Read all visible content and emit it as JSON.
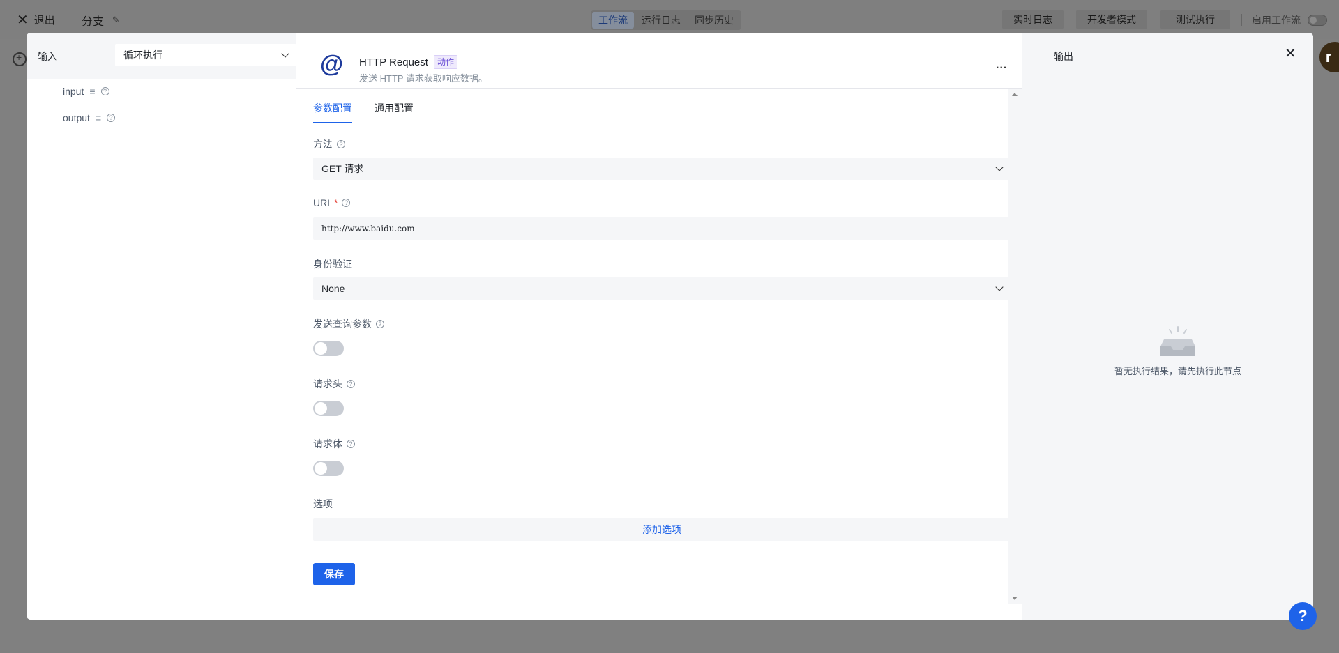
{
  "topbar": {
    "exit_label": "退出",
    "flow_name": "分支",
    "tabs": [
      {
        "label": "工作流",
        "active": true
      },
      {
        "label": "运行日志",
        "active": false
      },
      {
        "label": "同步历史",
        "active": false
      }
    ],
    "realtime_log": "实时日志",
    "developer_mode": "开发者模式",
    "test_run": "测试执行",
    "enable_workflow": "启用工作流",
    "avatar_letter": "r"
  },
  "input_panel": {
    "title": "输入",
    "loop_select": "循环执行",
    "vars": [
      {
        "name": "input"
      },
      {
        "name": "output"
      }
    ]
  },
  "node": {
    "title": "HTTP Request",
    "tag": "动作",
    "description": "发送 HTTP 请求获取响应数据。",
    "more": "..."
  },
  "tabs": [
    {
      "label": "参数配置",
      "active": true
    },
    {
      "label": "通用配置",
      "active": false
    }
  ],
  "form": {
    "method_label": "方法",
    "method_value": "GET 请求",
    "url_label": "URL",
    "url_required": "*",
    "url_value": "http://www.baidu.com",
    "auth_label": "身份验证",
    "auth_value": "None",
    "query_label": "发送查询参数",
    "query_enabled": false,
    "headers_label": "请求头",
    "headers_enabled": false,
    "body_label": "请求体",
    "body_enabled": false,
    "options_label": "选项",
    "add_option": "添加选项",
    "save": "保存"
  },
  "output_panel": {
    "title": "输出",
    "close": "✕",
    "empty_text": "暂无执行结果，请先执行此节点"
  },
  "help": "?",
  "colors": {
    "primary": "#1e63e9",
    "required": "#e33a2f",
    "tag": "#6b4fd6"
  }
}
